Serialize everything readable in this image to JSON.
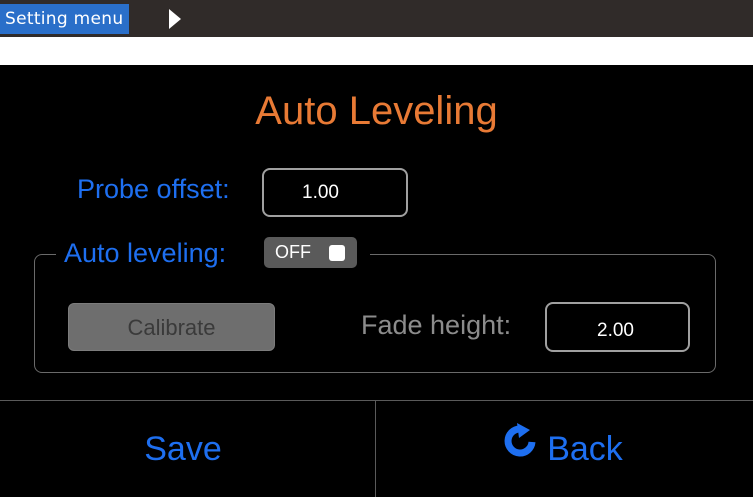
{
  "breadcrumb": {
    "label": "Setting menu",
    "arrow_icon": "triangle-right"
  },
  "screen": {
    "title": "Auto Leveling",
    "probe_offset": {
      "label": "Probe offset:",
      "value": "1.00"
    },
    "auto_leveling": {
      "label": "Auto leveling:",
      "toggle_text": "OFF",
      "state": "off"
    },
    "calibrate": {
      "label": "Calibrate",
      "enabled": false
    },
    "fade_height": {
      "label": "Fade height:",
      "value": "2.00"
    }
  },
  "footer": {
    "save_label": "Save",
    "back_label": "Back",
    "back_icon": "redo-arrow"
  },
  "colors": {
    "title": "#e87a35",
    "label_blue": "#1e6ff0",
    "breadcrumb_bg": "#2a6fc9",
    "topbar_bg": "#302b29",
    "screen_bg": "#000000"
  }
}
